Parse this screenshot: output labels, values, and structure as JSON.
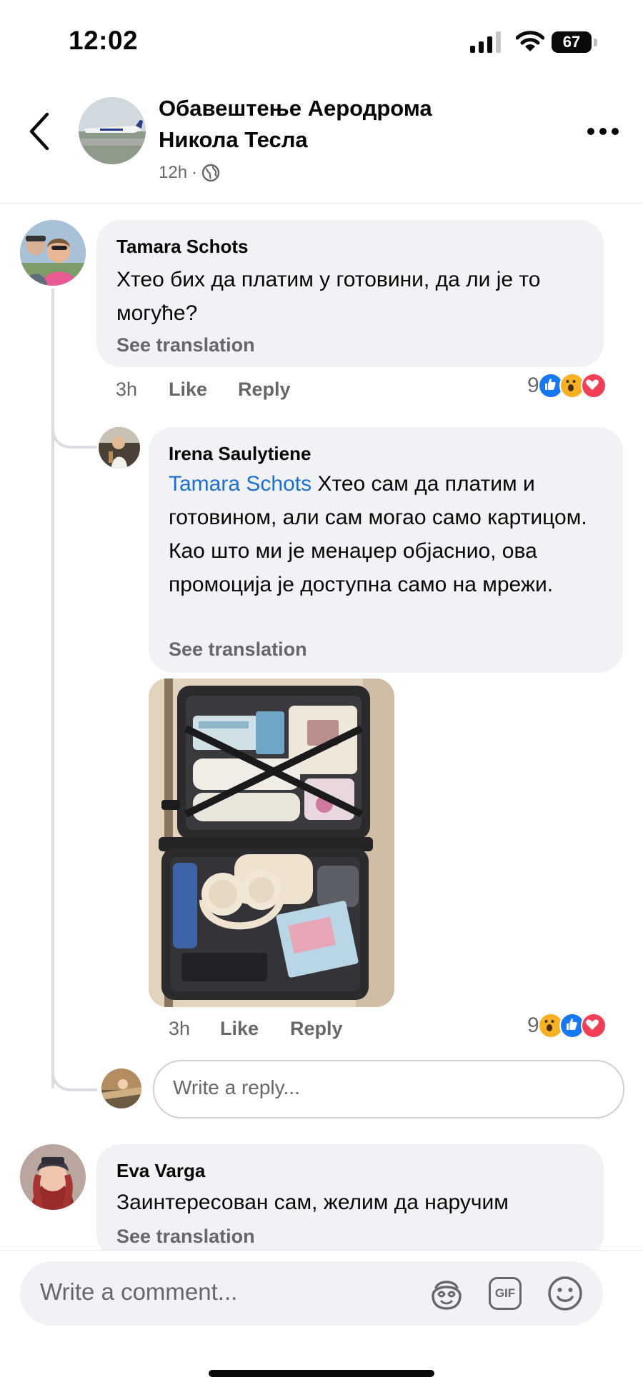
{
  "status_bar": {
    "time": "12:02",
    "battery": "67"
  },
  "header": {
    "title": "Обавештење Аеродрома Никола Тесла",
    "timestamp": "12h",
    "separator": "·",
    "privacy_icon": "globe-icon"
  },
  "comments": [
    {
      "author": "Tamara Schots",
      "text": "Хтео бих да платим у готовини, да ли је то могуће?",
      "see_translation": "See translation",
      "time": "3h",
      "like_label": "Like",
      "reply_label": "Reply",
      "reaction_count": "9",
      "reactions": [
        "like",
        "wow",
        "love"
      ]
    },
    {
      "author": "Irena Saulytiene",
      "mention": "Tamara Schots",
      "text": " Хтео сам да платим и готовином, али сам могао само картицом. Као што ми је менаџер објаснио, ова промоција је доступна само на мрежи.",
      "see_translation": "See translation",
      "attachment": "photo of an open suitcase with headphones, a book and clothes",
      "time": "3h",
      "like_label": "Like",
      "reply_label": "Reply",
      "reaction_count": "9",
      "reactions": [
        "wow",
        "like",
        "love"
      ]
    },
    {
      "author": "Eva Varga",
      "text": "Заинтересован сам, желим да наручим",
      "see_translation": "See translation"
    }
  ],
  "reply_input": {
    "placeholder": "Write a reply..."
  },
  "composer": {
    "placeholder": "Write a comment...",
    "icons": [
      "avatar-sticker-icon",
      "gif-icon",
      "emoji-icon"
    ],
    "gif_label": "GIF"
  },
  "colors": {
    "link_blue": "#1d6fd8",
    "like_blue": "#1877f2",
    "wow_yellow": "#f7b125",
    "love_red": "#f33e58",
    "bubble_gray": "#f0f2f5",
    "meta_gray": "#65676b"
  }
}
